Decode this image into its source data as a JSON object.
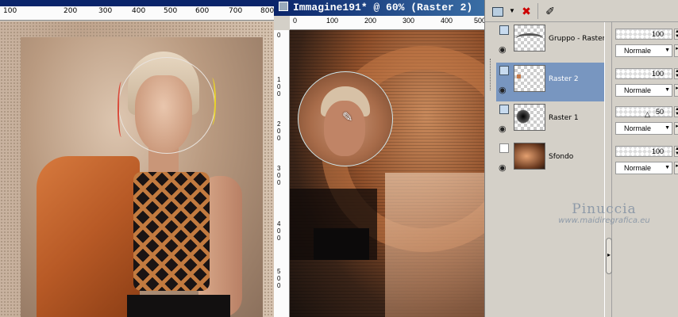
{
  "right_window": {
    "title": "Immagine191* @  60% (Raster 2)",
    "ruler_h_labels": [
      "0",
      "100",
      "200",
      "300",
      "400",
      "500"
    ],
    "ruler_v_labels": [
      "0",
      "100",
      "200",
      "300",
      "400",
      "500"
    ]
  },
  "left_window": {
    "ruler_labels": [
      "100",
      "200",
      "300",
      "400",
      "500",
      "600",
      "700",
      "800"
    ]
  },
  "layers_panel": {
    "toolbar": {
      "new_layer_icon": "new-raster-layer-icon",
      "delete_icon": "delete-layer-icon",
      "edit_icon": "edit-selection-icon"
    },
    "layers": [
      {
        "name": "Gruppo - Raster",
        "opacity": "100",
        "blend": "Normale",
        "selected": false,
        "thumb": "group"
      },
      {
        "name": "Raster 2",
        "opacity": "100",
        "blend": "Normale",
        "selected": true,
        "thumb": "r2"
      },
      {
        "name": "Raster 1",
        "opacity": "50",
        "blend": "Normale",
        "selected": false,
        "thumb": "r1"
      },
      {
        "name": "Sfondo",
        "opacity": "100",
        "blend": "Normale",
        "selected": false,
        "thumb": "bg"
      }
    ]
  },
  "watermark": {
    "name": "Pinuccia",
    "url": "www.maidiregrafica.eu"
  },
  "colors": {
    "title_bar": "#0a246a",
    "selected_layer": "#7896c0",
    "panel_bg": "#d4d0c8"
  }
}
